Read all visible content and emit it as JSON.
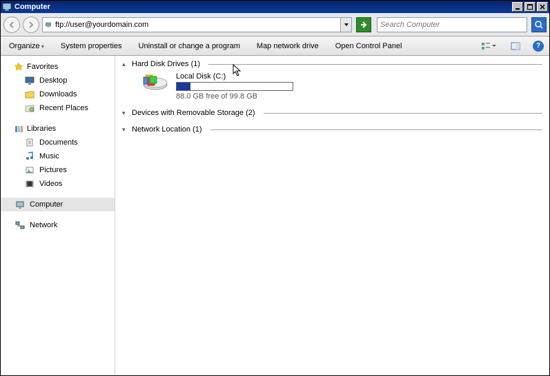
{
  "window": {
    "title": "Computer"
  },
  "nav": {
    "address": "ftp://user@yourdomain.com",
    "search_placeholder": "Search Computer"
  },
  "commands": {
    "organize": "Organize",
    "system_properties": "System properties",
    "uninstall": "Uninstall or change a program",
    "map_drive": "Map network drive",
    "control_panel": "Open Control Panel"
  },
  "tree": {
    "favorites": {
      "label": "Favorites",
      "items": [
        {
          "label": "Desktop"
        },
        {
          "label": "Downloads"
        },
        {
          "label": "Recent Places"
        }
      ]
    },
    "libraries": {
      "label": "Libraries",
      "items": [
        {
          "label": "Documents"
        },
        {
          "label": "Music"
        },
        {
          "label": "Pictures"
        },
        {
          "label": "Videos"
        }
      ]
    },
    "computer": {
      "label": "Computer"
    },
    "network": {
      "label": "Network"
    }
  },
  "groups": {
    "hdd": {
      "label": "Hard Disk Drives (1)"
    },
    "removable": {
      "label": "Devices with Removable Storage (2)"
    },
    "network": {
      "label": "Network Location (1)"
    }
  },
  "drive": {
    "name": "Local Disk (C:)",
    "fill_percent": 11.8,
    "subtext": "88.0 GB free of 99.8 GB"
  }
}
